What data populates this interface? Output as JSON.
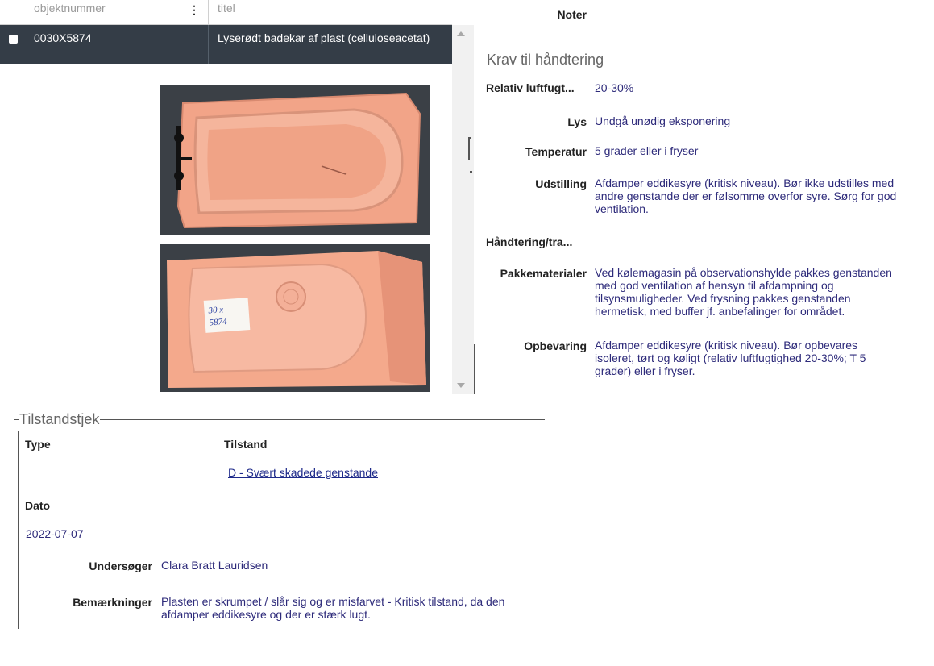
{
  "table": {
    "col_objektnummer": "objektnummer",
    "col_menu": "⋮",
    "col_titel": "titel",
    "row": {
      "objektnummer": "0030X5874",
      "titel": "Lyserødt badekar af plast (celluloseacetat)"
    }
  },
  "photos": {
    "label_text_line1": "30 x",
    "label_text_line2": "5874"
  },
  "noter_label": "Noter",
  "krav": {
    "legend": "Krav til håndtering",
    "fields": [
      {
        "label": "Relativ luftfugt...",
        "value": "20-30%"
      },
      {
        "label": "Lys",
        "value": "Undgå unødig eksponering"
      },
      {
        "label": "Temperatur",
        "value": "5 grader eller i fryser"
      },
      {
        "label": "Udstilling",
        "value": "Afdamper eddikesyre (kritisk niveau). Bør ikke udstilles med andre genstande der er følsomme overfor syre. Sørg for god ventilation."
      },
      {
        "label": "Håndtering/tra...",
        "value": ""
      },
      {
        "label": "Pakkematerialer",
        "value": "Ved kølemagasin på observationshylde pakkes genstanden med god ventilation af hensyn til afdampning og tilsynsmuligheder. Ved frysning pakkes genstanden hermetisk, med buffer jf. anbefalinger for området."
      },
      {
        "label": "Opbevaring",
        "value": "Afdamper eddikesyre (kritisk niveau). Bør opbevares isoleret, tørt  og køligt (relativ luftfugtighed 20-30%; T 5 grader) eller i fryser."
      }
    ]
  },
  "tilstandstjek": {
    "legend": "Tilstandstjek",
    "type_label": "Type",
    "tilstand_label": "Tilstand",
    "tilstand_value": "D - Svært skadede genstande",
    "dato_label": "Dato",
    "dato_value": "2022-07-07",
    "undersoger_label": "Undersøger",
    "undersoger_value": "Clara Bratt Lauridsen",
    "bemaerkninger_label": "Bemærkninger",
    "bemaerkninger_value": "Plasten er skrumpet / slår sig og er misfarvet - Kritisk tilstand, da den afdamper eddikesyre og der er stærk lugt."
  },
  "colors": {
    "row_bg": "#343d47",
    "value_text": "#2d2a7a",
    "link": "#1e2a8a",
    "plastic_pink": "#f4a98c"
  }
}
